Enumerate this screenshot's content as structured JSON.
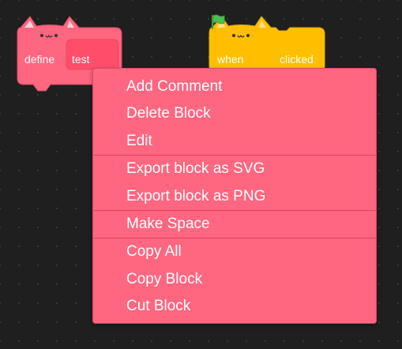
{
  "workspace": {
    "define_block": {
      "keyword": "define",
      "name": "test",
      "color": "#ff6680"
    },
    "hat_block": {
      "before_icon": "when",
      "icon": "green-flag-icon",
      "after_icon": "clicked",
      "color": "#ffbf00"
    }
  },
  "context_menu": {
    "color": "#ff6680",
    "groups": [
      [
        "Add Comment",
        "Delete Block",
        "Edit"
      ],
      [
        "Export block as SVG",
        "Export block as PNG"
      ],
      [
        "Make Space"
      ],
      [
        "Copy All",
        "Copy Block",
        "Cut Block"
      ]
    ]
  }
}
